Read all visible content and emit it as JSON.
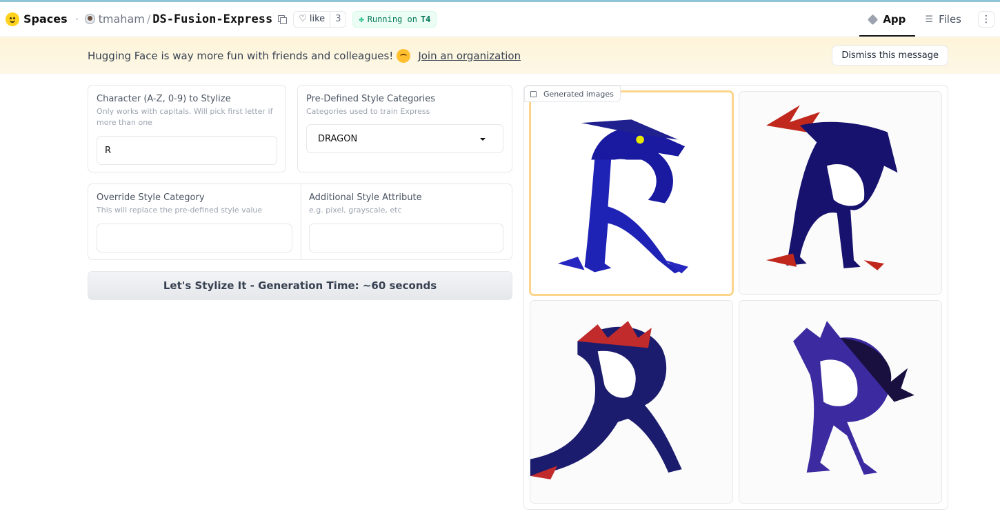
{
  "header": {
    "spaces_label": "Spaces",
    "owner": "tmaham",
    "slash": "/",
    "repo_name": "DS-Fusion-Express",
    "like_label": "like",
    "like_count": "3",
    "status_prefix": "Running on",
    "status_hardware": "T4",
    "tabs": [
      {
        "label": "App",
        "icon": "cube-icon",
        "active": true
      },
      {
        "label": "Files",
        "icon": "files-icon",
        "active": false
      }
    ],
    "more_label": "⋮"
  },
  "banner": {
    "text": "Hugging Face is way more fun with friends and colleagues!",
    "link": "Join an organization",
    "dismiss": "Dismiss this message"
  },
  "form": {
    "character": {
      "label": "Character (A-Z, 0-9) to Stylize",
      "info": "Only works with capitals. Will pick first letter if more than one",
      "value": "R"
    },
    "style_category": {
      "label": "Pre-Defined Style Categories",
      "info": "Categories used to train Express",
      "selected": "DRAGON"
    },
    "override": {
      "label": "Override Style Category",
      "info": "This will replace the pre-defined style value",
      "value": ""
    },
    "additional": {
      "label": "Additional Style Attribute",
      "info": "e.g. pixel, grayscale, etc",
      "value": ""
    },
    "generate_button": "Let's Stylize It - Generation Time: ~60 seconds"
  },
  "gallery": {
    "label": "Generated images",
    "images": [
      {
        "name": "dragon-letter-r-1",
        "selected": true
      },
      {
        "name": "dragon-letter-r-2",
        "selected": false
      },
      {
        "name": "dragon-letter-r-3",
        "selected": false
      },
      {
        "name": "dragon-letter-r-4",
        "selected": false
      }
    ]
  },
  "colors": {
    "accent_line": "#8ec5d8",
    "banner_bg": "#fdf4d9",
    "status_green": "#047857",
    "selected_border": "#fcd58b"
  }
}
